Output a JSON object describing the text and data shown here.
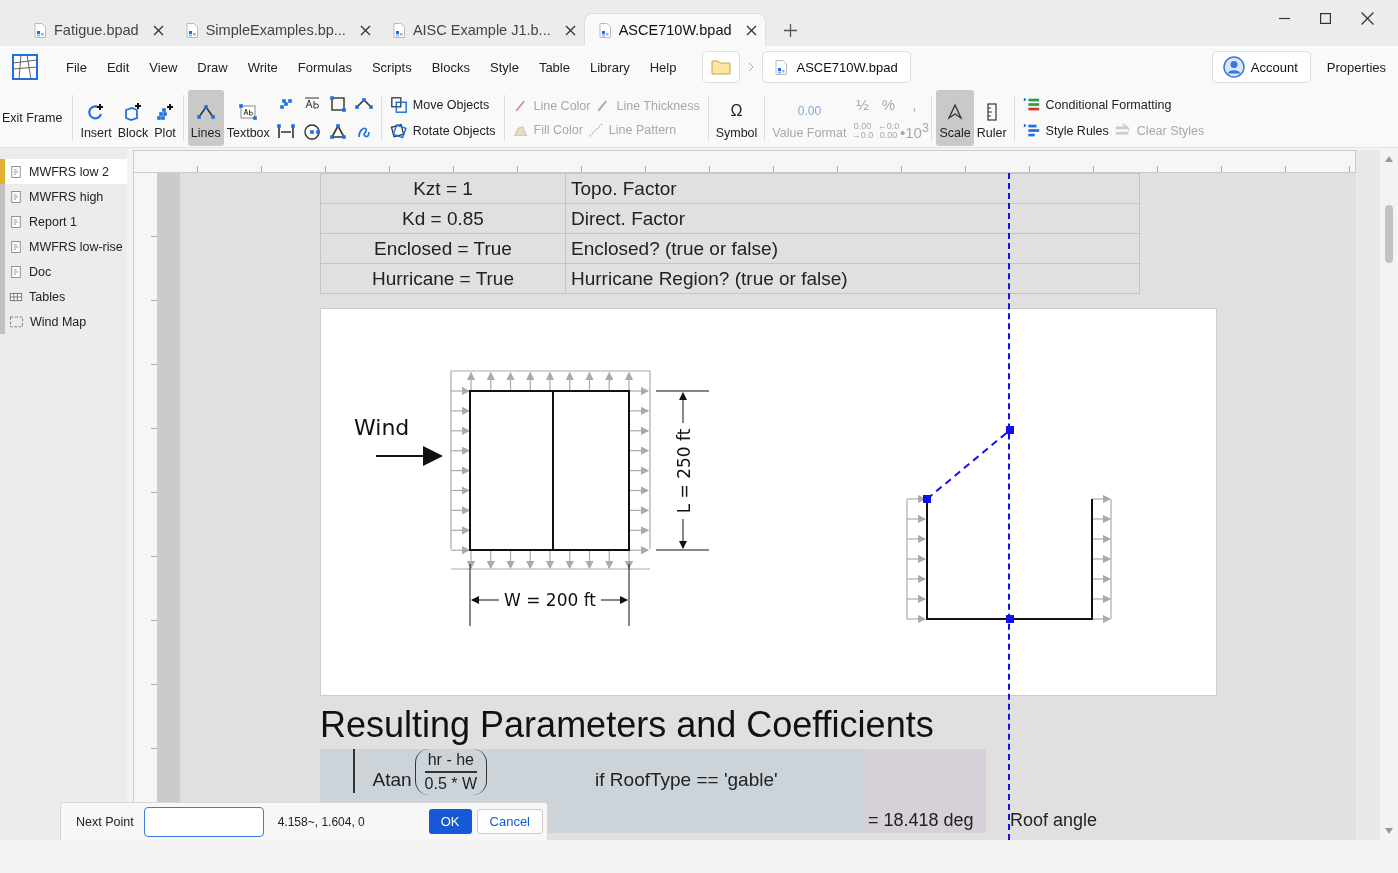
{
  "tabs": [
    {
      "label": "Fatigue.bpad",
      "selected": false
    },
    {
      "label": "SimpleExamples.bp...",
      "selected": false
    },
    {
      "label": "AISC Example J1.b...",
      "selected": false
    },
    {
      "label": "ASCE710W.bpad",
      "selected": true
    }
  ],
  "menu": [
    "File",
    "Edit",
    "View",
    "Draw",
    "Write",
    "Formulas",
    "Scripts",
    "Blocks",
    "Style",
    "Table",
    "Library",
    "Help"
  ],
  "breadcrumb": {
    "file": "ASCE710W.bpad"
  },
  "account": "Account",
  "properties": "Properties",
  "toolbar": {
    "exit_frame": {
      "label": "Exit Frame"
    },
    "insert": {
      "label": "Insert"
    },
    "block": {
      "label": "Block"
    },
    "plot": {
      "label": "Plot"
    },
    "lines": {
      "label": "Lines",
      "selected": true
    },
    "textbox": {
      "label": "Textbox",
      "selected": false
    },
    "move_objects": {
      "label": "Move Objects"
    },
    "rotate_objects": {
      "label": "Rotate Objects"
    },
    "line_color": {
      "label": "Line Color",
      "disabled": true
    },
    "line_thickness": {
      "label": "Line Thickness",
      "disabled": true
    },
    "fill_color": {
      "label": "Fill Color",
      "disabled": true
    },
    "line_pattern": {
      "label": "Line Pattern",
      "disabled": true
    },
    "symbol": {
      "label": "Symbol",
      "glyph": "Ω"
    },
    "value_format": {
      "label": "Value Format",
      "glyph": "0.00",
      "disabled": true
    },
    "scale": {
      "label": "Scale",
      "selected": true
    },
    "ruler": {
      "label": "Ruler",
      "selected": false
    },
    "conditional_formatting": {
      "label": "Conditional Formatting"
    },
    "style_rules": {
      "label": "Style Rules"
    },
    "clear_styles": {
      "label": "Clear Styles",
      "disabled": true
    }
  },
  "number_format": [
    {
      "lines": [
        "½"
      ],
      "disabled": true
    },
    {
      "lines": [
        "%"
      ],
      "disabled": true
    },
    {
      "lines": [
        ","
      ],
      "disabled": true
    },
    {
      "lines": [
        "0.00",
        "→0.0"
      ],
      "disabled": true
    },
    {
      "lines": [
        "←0.0",
        "0.00"
      ],
      "disabled": true
    },
    {
      "lines": [
        "•10$^{3}$"
      ],
      "disabled": true
    }
  ],
  "sidebar": {
    "items": [
      {
        "label": "MWFRS low 2",
        "kind": "doc",
        "selected": true
      },
      {
        "label": "MWFRS high",
        "kind": "doc",
        "selected": false
      },
      {
        "label": "Report 1",
        "kind": "doc",
        "selected": false
      },
      {
        "label": "MWFRS low-rise",
        "kind": "doc",
        "selected": false
      },
      {
        "label": "Doc",
        "kind": "doc",
        "selected": false
      },
      {
        "label": "Tables",
        "kind": "table",
        "selected": false
      },
      {
        "label": "Wind Map",
        "kind": "map",
        "selected": false
      }
    ]
  },
  "table": {
    "rows": [
      {
        "value": "Kzt = 1",
        "description": "Topo. Factor"
      },
      {
        "value": "Kd = 0.85",
        "description": "Direct. Factor"
      },
      {
        "value": "Enclosed = True",
        "description": "Enclosed? (true or false)"
      },
      {
        "value": "Hurricane = True",
        "description": "Hurricane Region? (true or false)"
      }
    ]
  },
  "figure": {
    "wind_label": "Wind",
    "length_label": "L = 250 ft",
    "width_label": "W = 200 ft"
  },
  "heading": "Resulting Parameters and Coefficients",
  "formula": {
    "function": "Atan",
    "numerator": "hr - he",
    "denominator": "0.5 * W",
    "condition": "if RoofType == 'gable'",
    "result": "= 18.418 deg",
    "description": "Roof angle"
  },
  "dialog": {
    "label": "Next Point",
    "coordinates": "4.158~, 1.604, 0",
    "ok": "OK",
    "cancel": "Cancel"
  }
}
